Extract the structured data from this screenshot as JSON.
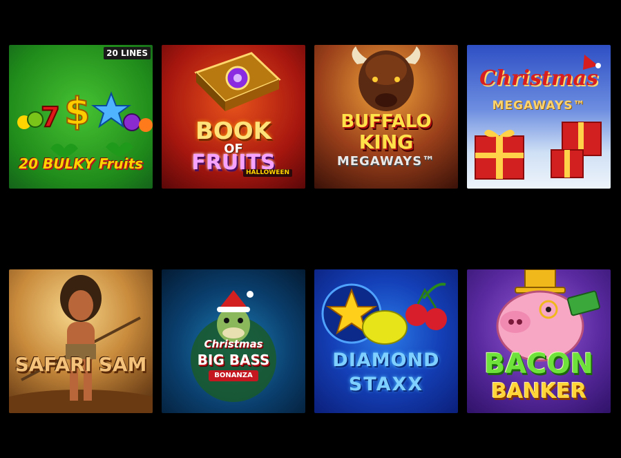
{
  "page": {
    "background": "#000000"
  },
  "games": [
    {
      "id": "20-bulky-fruits",
      "badge": "20 LINES",
      "title_line1": "20 BULKY Fruits"
    },
    {
      "id": "book-of-fruits-halloween",
      "title_line1": "BOOK",
      "title_line2": "OF",
      "title_line3": "FRUITS",
      "subtitle": "HALLOWEEN"
    },
    {
      "id": "buffalo-king-megaways",
      "title_line1": "BUFFALO",
      "title_line2": "KING",
      "title_line3": "MEGAWAYS™"
    },
    {
      "id": "christmas-megaways",
      "title_line1": "Christmas",
      "title_line2": "MEGAWAYS™"
    },
    {
      "id": "safari-sam",
      "title_line1": "SAFARI SAM"
    },
    {
      "id": "christmas-big-bass-bonanza",
      "title_line1": "Christmas",
      "title_line2": "BIG BASS",
      "title_line3": "BONANZA"
    },
    {
      "id": "diamond-staxx",
      "title_line1": "DIAMOND",
      "title_line2": "STAXX"
    },
    {
      "id": "bacon-banker",
      "title_line1": "BACON",
      "title_line2": "BANKER"
    }
  ]
}
